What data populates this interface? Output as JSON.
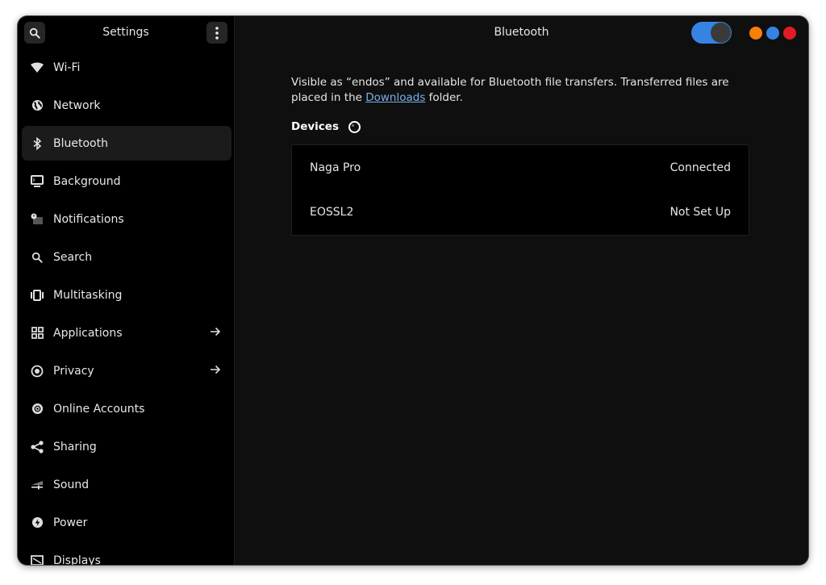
{
  "sidebar": {
    "title": "Settings",
    "items": [
      {
        "label": "Wi-Fi",
        "icon": "wifi-icon",
        "active": false,
        "arrow": false
      },
      {
        "label": "Network",
        "icon": "network-icon",
        "active": false,
        "arrow": false
      },
      {
        "label": "Bluetooth",
        "icon": "bluetooth-icon",
        "active": true,
        "arrow": false
      },
      {
        "label": "Background",
        "icon": "background-icon",
        "active": false,
        "arrow": false
      },
      {
        "label": "Notifications",
        "icon": "notifications-icon",
        "active": false,
        "arrow": false
      },
      {
        "label": "Search",
        "icon": "search-icon",
        "active": false,
        "arrow": false
      },
      {
        "label": "Multitasking",
        "icon": "multitasking-icon",
        "active": false,
        "arrow": false
      },
      {
        "label": "Applications",
        "icon": "applications-icon",
        "active": false,
        "arrow": true
      },
      {
        "label": "Privacy",
        "icon": "privacy-icon",
        "active": false,
        "arrow": true
      },
      {
        "label": "Online Accounts",
        "icon": "online-accounts-icon",
        "active": false,
        "arrow": false
      },
      {
        "label": "Sharing",
        "icon": "sharing-icon",
        "active": false,
        "arrow": false
      },
      {
        "label": "Sound",
        "icon": "sound-icon",
        "active": false,
        "arrow": false
      },
      {
        "label": "Power",
        "icon": "power-icon",
        "active": false,
        "arrow": false
      },
      {
        "label": "Displays",
        "icon": "displays-icon",
        "active": false,
        "arrow": false
      }
    ]
  },
  "main": {
    "title": "Bluetooth",
    "bluetooth_enabled": true,
    "description_before": "Visible as “endos” and available for Bluetooth file transfers. Transferred files are placed in the ",
    "description_link": "Downloads",
    "description_after": " folder.",
    "devices_heading": "Devices",
    "devices": [
      {
        "name": "Naga Pro",
        "status": "Connected"
      },
      {
        "name": "EOSSL2",
        "status": "Not Set Up"
      }
    ]
  },
  "colors": {
    "accent": "#3584e4",
    "minimize": "#f97f0a",
    "maximize": "#3584e4",
    "close": "#e01b24",
    "link": "#78aeed"
  }
}
